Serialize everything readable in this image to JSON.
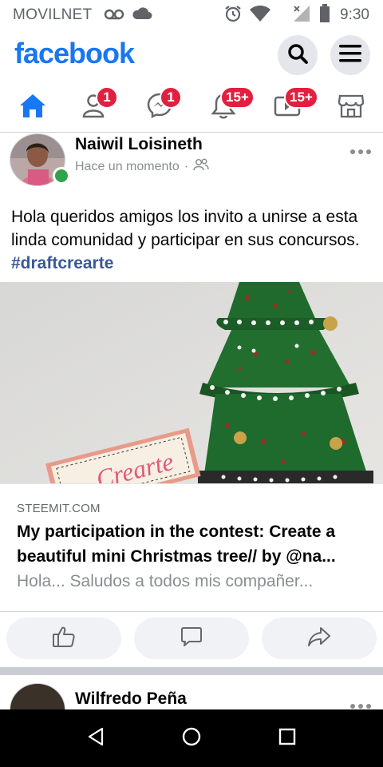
{
  "status_bar": {
    "carrier": "MOVILNET",
    "time": "9:30",
    "icons": [
      "voicemail-icon",
      "cloud-icon",
      "alarm-icon",
      "wifi-icon",
      "signal-icon",
      "battery-icon"
    ]
  },
  "header": {
    "logo": "facebook",
    "brand_color": "#1877f2",
    "buttons": [
      "search-icon",
      "menu-icon"
    ]
  },
  "nav": {
    "tabs": [
      {
        "name": "home",
        "icon": "home-icon",
        "active": true,
        "badge": ""
      },
      {
        "name": "friends",
        "icon": "friends-icon",
        "active": false,
        "badge": "1"
      },
      {
        "name": "messenger",
        "icon": "messenger-icon",
        "active": false,
        "badge": "1"
      },
      {
        "name": "notifications",
        "icon": "bell-icon",
        "active": false,
        "badge": "15+"
      },
      {
        "name": "watch",
        "icon": "video-icon",
        "active": false,
        "badge": "15+"
      },
      {
        "name": "marketplace",
        "icon": "marketplace-icon",
        "active": false,
        "badge": ""
      }
    ],
    "badge_color": "#e41e3f"
  },
  "post": {
    "author": "Naiwil Loisineth",
    "timestamp": "Hace un momento",
    "separator": "·",
    "privacy_icon": "friends-icon",
    "text": "Hola queridos amigos los invito a unirse a esta linda comunidad y participar en sus concursos.",
    "hashtag": "#draftcrearte",
    "link": {
      "image_sign_text": "Crearte",
      "domain": "STEEMIT.COM",
      "title": "My participation in the contest: Create a beautiful mini Christmas tree// by @na...",
      "description": "Hola... Saludos a todos mis compañer..."
    },
    "actions": [
      "like-icon",
      "comment-icon",
      "share-icon"
    ]
  },
  "next_post": {
    "author": "Wilfredo Peña"
  },
  "system_nav": [
    "back-icon",
    "home-circle-icon",
    "recents-icon"
  ]
}
